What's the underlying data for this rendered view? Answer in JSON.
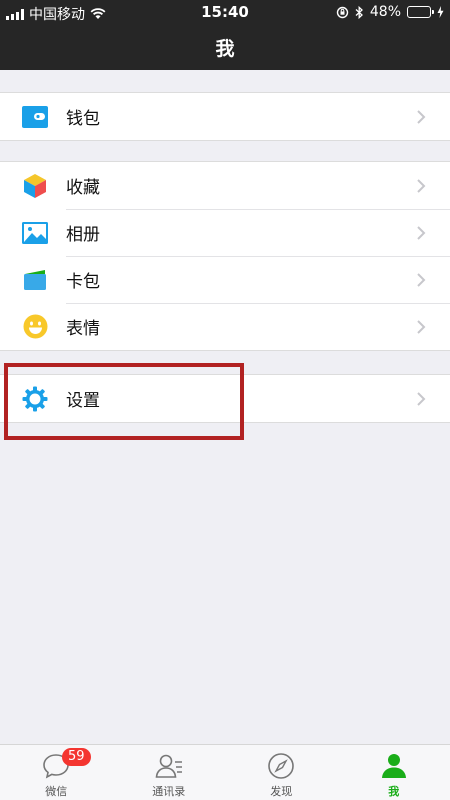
{
  "status_bar": {
    "carrier": "中国移动",
    "time": "15:40",
    "battery": "48%",
    "battery_level": 0.48
  },
  "header": {
    "title": "我"
  },
  "groups": {
    "wallet": [
      {
        "label": "钱包",
        "icon": "wallet-icon"
      }
    ],
    "media": [
      {
        "label": "收藏",
        "icon": "favorites-cube-icon"
      },
      {
        "label": "相册",
        "icon": "album-icon"
      },
      {
        "label": "卡包",
        "icon": "card-icon"
      },
      {
        "label": "表情",
        "icon": "emoji-smiley-icon"
      }
    ],
    "settings": [
      {
        "label": "设置",
        "icon": "gear-icon"
      }
    ]
  },
  "tabs": [
    {
      "label": "微信",
      "icon": "chat-bubble-icon",
      "badge": "59"
    },
    {
      "label": "通讯录",
      "icon": "contacts-icon"
    },
    {
      "label": "发现",
      "icon": "compass-icon"
    },
    {
      "label": "我",
      "icon": "person-icon",
      "active": true
    }
  ],
  "colors": {
    "accent_green": "#1aad19",
    "header_bg": "#262626",
    "icon_blue": "#1aa0e8",
    "badge_red": "#f43530",
    "highlight_red": "#b22222"
  }
}
